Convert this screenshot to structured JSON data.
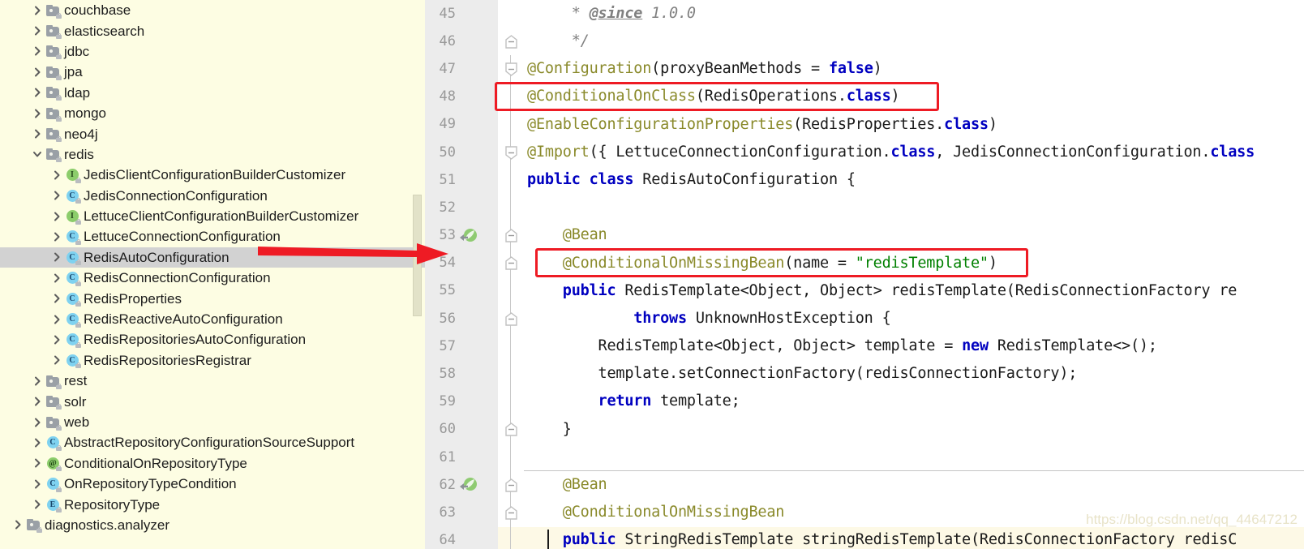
{
  "sidebar": {
    "background_color": "#fdfde3",
    "selected_row_color": "#d2d2d2",
    "tree": [
      {
        "label": "couchbase",
        "icon": "folder-icon",
        "indent": 1,
        "arrow": "chevron-right-icon",
        "selected": false
      },
      {
        "label": "elasticsearch",
        "icon": "folder-icon",
        "indent": 1,
        "arrow": "chevron-right-icon",
        "selected": false
      },
      {
        "label": "jdbc",
        "icon": "folder-icon",
        "indent": 1,
        "arrow": "chevron-right-icon",
        "selected": false
      },
      {
        "label": "jpa",
        "icon": "folder-icon",
        "indent": 1,
        "arrow": "chevron-right-icon",
        "selected": false
      },
      {
        "label": "ldap",
        "icon": "folder-icon",
        "indent": 1,
        "arrow": "chevron-right-icon",
        "selected": false
      },
      {
        "label": "mongo",
        "icon": "folder-icon",
        "indent": 1,
        "arrow": "chevron-right-icon",
        "selected": false
      },
      {
        "label": "neo4j",
        "icon": "folder-icon",
        "indent": 1,
        "arrow": "chevron-right-icon",
        "selected": false
      },
      {
        "label": "redis",
        "icon": "folder-icon",
        "indent": 1,
        "arrow": "chevron-down-icon",
        "selected": false
      },
      {
        "label": "JedisClientConfigurationBuilderCustomizer",
        "icon": "interface-icon",
        "indent": 2,
        "arrow": "chevron-right-icon",
        "selected": false
      },
      {
        "label": "JedisConnectionConfiguration",
        "icon": "class-icon",
        "indent": 2,
        "arrow": "chevron-right-icon",
        "selected": false
      },
      {
        "label": "LettuceClientConfigurationBuilderCustomizer",
        "icon": "interface-icon",
        "indent": 2,
        "arrow": "chevron-right-icon",
        "selected": false
      },
      {
        "label": "LettuceConnectionConfiguration",
        "icon": "class-icon",
        "indent": 2,
        "arrow": "chevron-right-icon",
        "selected": false
      },
      {
        "label": "RedisAutoConfiguration",
        "icon": "class-icon",
        "indent": 2,
        "arrow": "chevron-right-icon",
        "selected": true
      },
      {
        "label": "RedisConnectionConfiguration",
        "icon": "class-icon",
        "indent": 2,
        "arrow": "chevron-right-icon",
        "selected": false
      },
      {
        "label": "RedisProperties",
        "icon": "class-icon",
        "indent": 2,
        "arrow": "chevron-right-icon",
        "selected": false
      },
      {
        "label": "RedisReactiveAutoConfiguration",
        "icon": "class-icon",
        "indent": 2,
        "arrow": "chevron-right-icon",
        "selected": false
      },
      {
        "label": "RedisRepositoriesAutoConfiguration",
        "icon": "class-icon",
        "indent": 2,
        "arrow": "chevron-right-icon",
        "selected": false
      },
      {
        "label": "RedisRepositoriesRegistrar",
        "icon": "class-icon",
        "indent": 2,
        "arrow": "chevron-right-icon",
        "selected": false
      },
      {
        "label": "rest",
        "icon": "folder-icon",
        "indent": 1,
        "arrow": "chevron-right-icon",
        "selected": false
      },
      {
        "label": "solr",
        "icon": "folder-icon",
        "indent": 1,
        "arrow": "chevron-right-icon",
        "selected": false
      },
      {
        "label": "web",
        "icon": "folder-icon",
        "indent": 1,
        "arrow": "chevron-right-icon",
        "selected": false
      },
      {
        "label": "AbstractRepositoryConfigurationSourceSupport",
        "icon": "class-icon",
        "indent": 1,
        "arrow": "chevron-right-icon",
        "selected": false
      },
      {
        "label": "ConditionalOnRepositoryType",
        "icon": "annotation-icon",
        "indent": 1,
        "arrow": "chevron-right-icon",
        "selected": false
      },
      {
        "label": "OnRepositoryTypeCondition",
        "icon": "class-icon",
        "indent": 1,
        "arrow": "chevron-right-icon",
        "selected": false
      },
      {
        "label": "RepositoryType",
        "icon": "enum-icon",
        "indent": 1,
        "arrow": "chevron-right-icon",
        "selected": false
      },
      {
        "label": "diagnostics.analyzer",
        "icon": "folder-icon",
        "indent": 0,
        "arrow": "chevron-right-icon",
        "selected": false
      }
    ]
  },
  "editor": {
    "first_visible_line": 45,
    "caret_line": 64,
    "gutter_background": "#ececec",
    "caret_line_background": "#fdf9e6",
    "lines": [
      {
        "no": 45,
        "fold": "none",
        "bean": false,
        "text": "     * @since 1.0.0"
      },
      {
        "no": 46,
        "fold": "end",
        "bean": false,
        "text": "     */"
      },
      {
        "no": 47,
        "fold": "start",
        "bean": false,
        "text": "@Configuration(proxyBeanMethods = false)"
      },
      {
        "no": 48,
        "fold": "none",
        "bean": false,
        "text": "@ConditionalOnClass(RedisOperations.class)"
      },
      {
        "no": 49,
        "fold": "none",
        "bean": false,
        "text": "@EnableConfigurationProperties(RedisProperties.class)"
      },
      {
        "no": 50,
        "fold": "start",
        "bean": false,
        "text": "@Import({ LettuceConnectionConfiguration.class, JedisConnectionConfiguration.class"
      },
      {
        "no": 51,
        "fold": "none",
        "bean": false,
        "text": "public class RedisAutoConfiguration {"
      },
      {
        "no": 52,
        "fold": "none",
        "bean": false,
        "text": ""
      },
      {
        "no": 53,
        "fold": "mid",
        "bean": true,
        "text": "    @Bean"
      },
      {
        "no": 54,
        "fold": "mid",
        "bean": false,
        "text": "    @ConditionalOnMissingBean(name = \"redisTemplate\")"
      },
      {
        "no": 55,
        "fold": "none",
        "bean": false,
        "text": "    public RedisTemplate<Object, Object> redisTemplate(RedisConnectionFactory re"
      },
      {
        "no": 56,
        "fold": "mid",
        "bean": false,
        "text": "            throws UnknownHostException {"
      },
      {
        "no": 57,
        "fold": "none",
        "bean": false,
        "text": "        RedisTemplate<Object, Object> template = new RedisTemplate<>();"
      },
      {
        "no": 58,
        "fold": "none",
        "bean": false,
        "text": "        template.setConnectionFactory(redisConnectionFactory);"
      },
      {
        "no": 59,
        "fold": "none",
        "bean": false,
        "text": "        return template;"
      },
      {
        "no": 60,
        "fold": "end",
        "bean": false,
        "text": "    }"
      },
      {
        "no": 61,
        "fold": "none",
        "bean": false,
        "text": ""
      },
      {
        "no": 62,
        "fold": "mid",
        "bean": true,
        "text": "    @Bean"
      },
      {
        "no": 63,
        "fold": "mid",
        "bean": false,
        "text": "    @ConditionalOnMissingBean"
      },
      {
        "no": 64,
        "fold": "none",
        "bean": false,
        "text": "    public StringRedisTemplate stringRedisTemplate(RedisConnectionFactory redisC"
      }
    ],
    "syntax_colors": {
      "keyword": "#0000c0",
      "annotation": "#8a8a2b",
      "string": "#008000",
      "comment": "#808080",
      "plain": "#1a1a1a"
    }
  },
  "annotations": {
    "highlight_color": "#ee1b24",
    "boxes": [
      {
        "name": "conditional-on-class-highlight",
        "target_line": 48
      },
      {
        "name": "conditional-on-missing-bean-highlight",
        "target_line": 54
      }
    ],
    "arrow": {
      "name": "pointer-arrow",
      "from": "RedisAutoConfiguration",
      "to_line": 54
    }
  },
  "watermark": {
    "text": "https://blog.csdn.net/qq_44647212"
  }
}
